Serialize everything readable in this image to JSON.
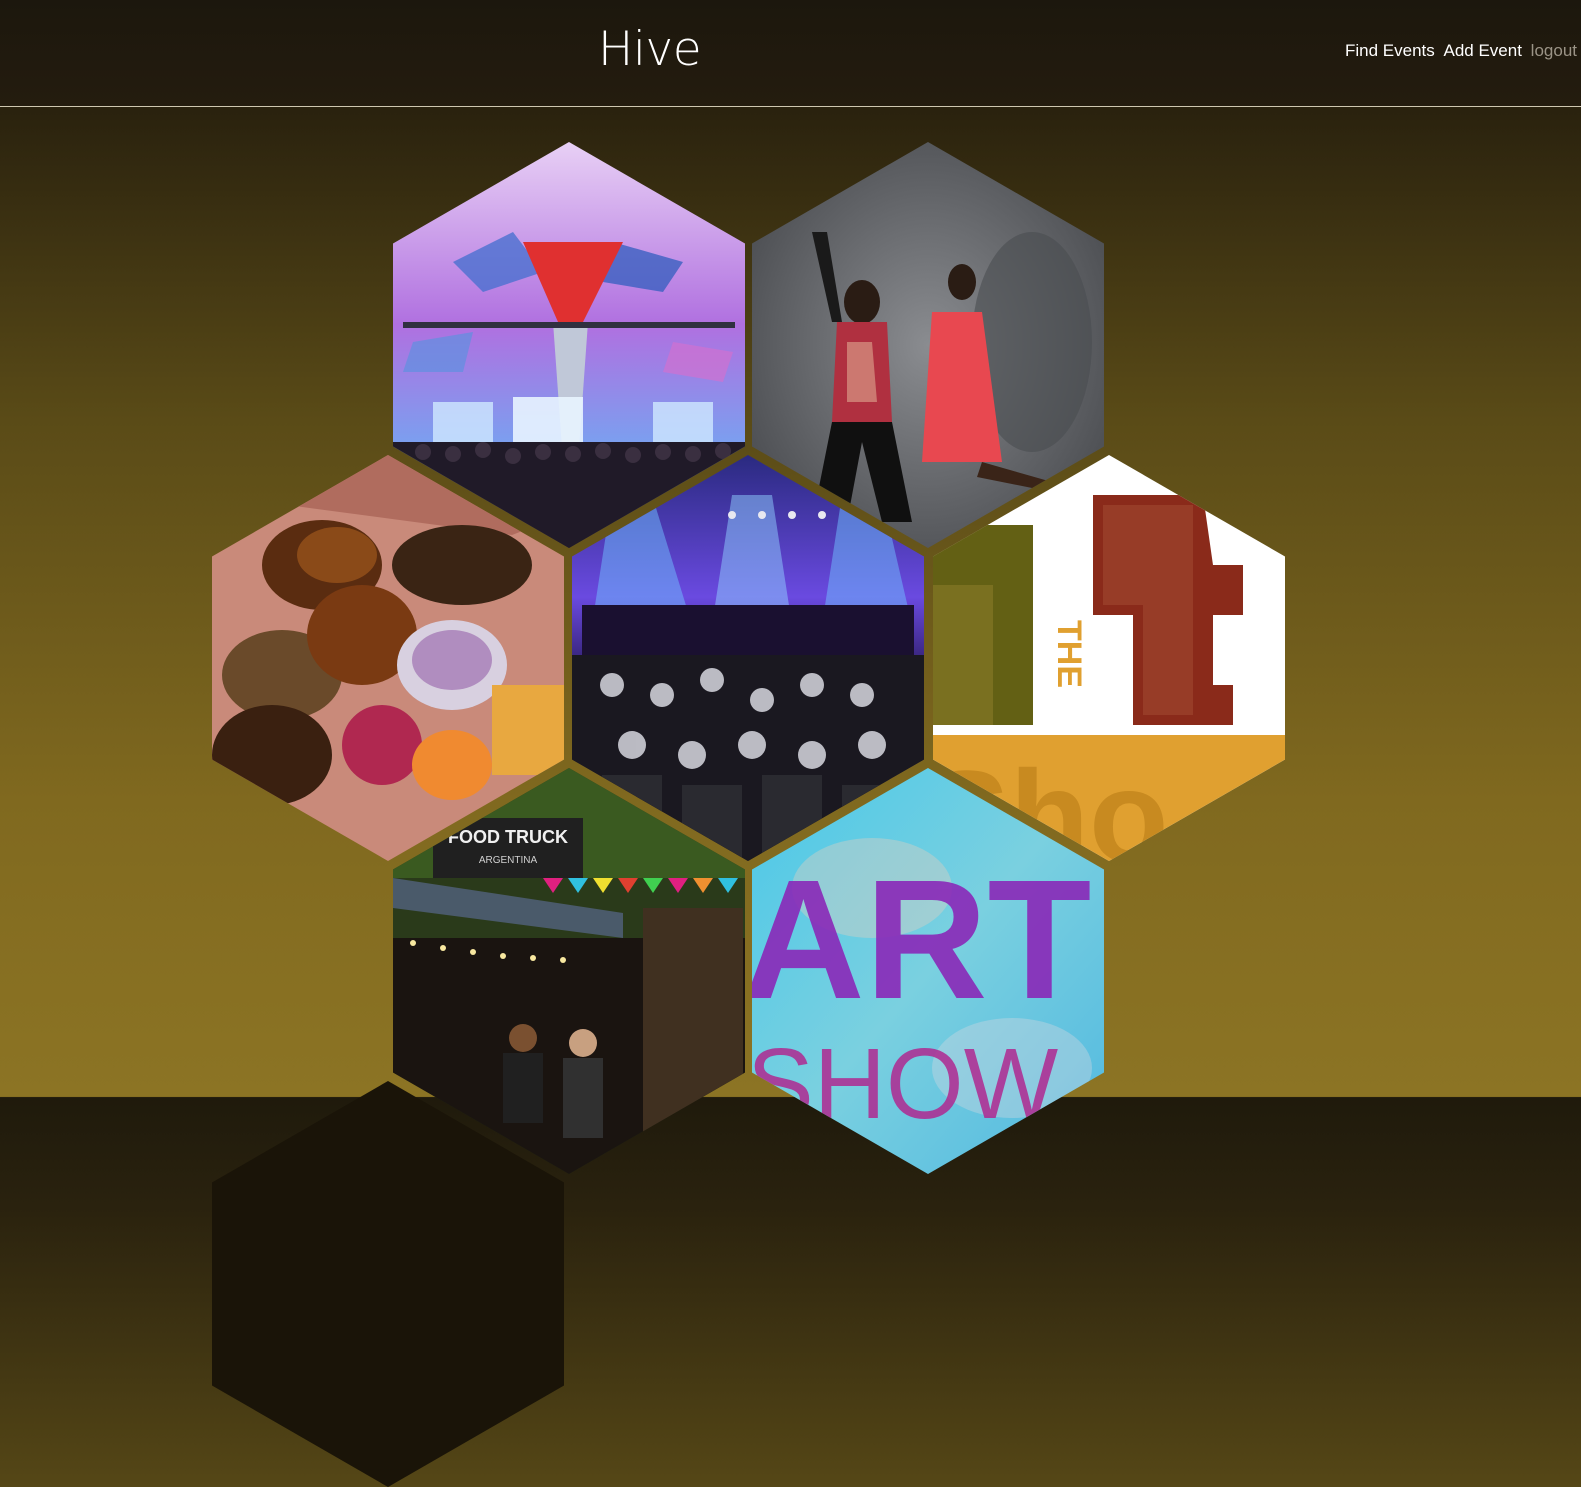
{
  "header": {
    "logo": "Hive",
    "nav": {
      "find_events": "Find Events",
      "add_event": "Add Event",
      "logout": "logout"
    }
  },
  "tiles": {
    "art_show_1": {
      "the": "THE",
      "rt": "rt",
      "sho": "Sho"
    },
    "art_show_2": {
      "art": "ART",
      "show": "SHOW"
    },
    "food_truck": {
      "sign": "FOOD TRUCK",
      "sub": "ARGENTINA"
    }
  },
  "colors": {
    "text_primary": "#ffffff",
    "text_muted": "#9a9386",
    "header_border": "#cfc7b0",
    "gold": "#e0a030"
  }
}
